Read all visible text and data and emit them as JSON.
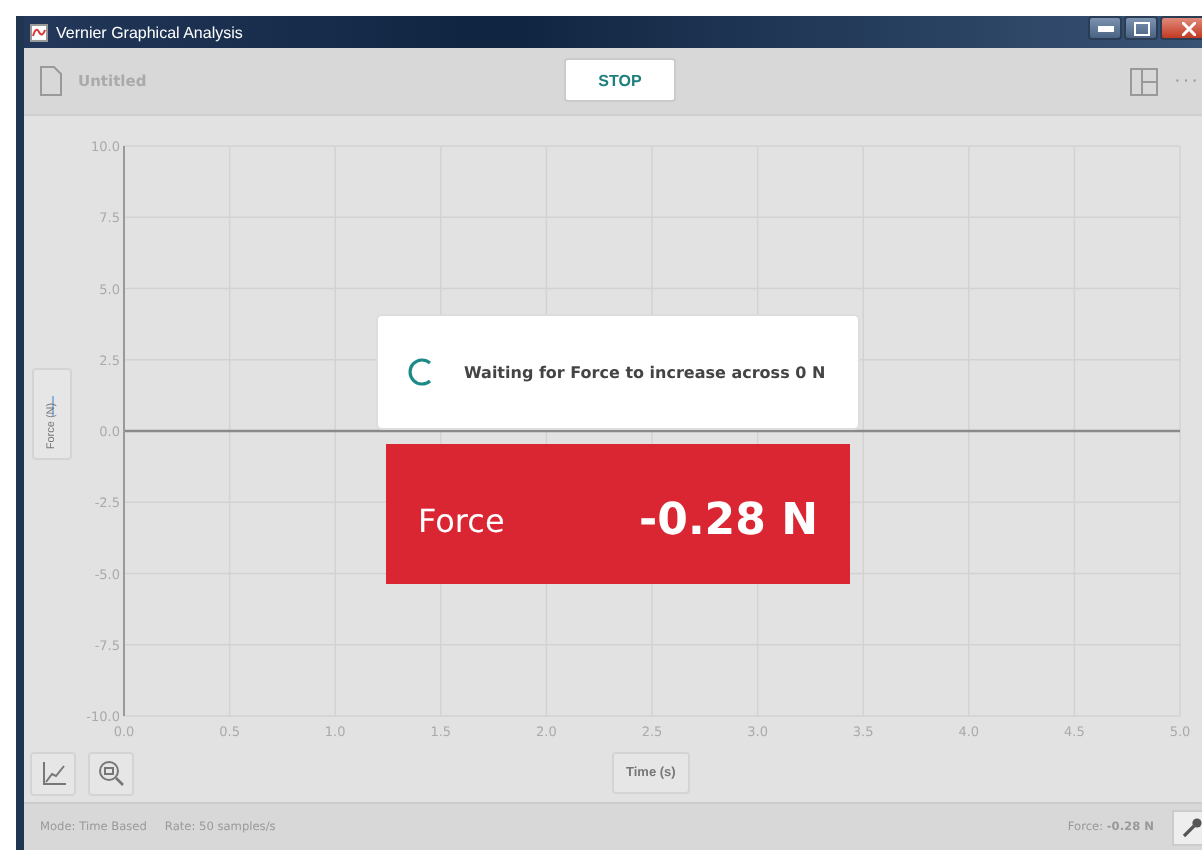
{
  "window": {
    "title": "Vernier Graphical Analysis"
  },
  "toolbar": {
    "file_name": "Untitled",
    "collect_button": "STOP",
    "more_button": "···"
  },
  "graph": {
    "chart_data": {
      "type": "line",
      "grid": true,
      "xlabel": "Time (s)",
      "ylabel": "Force (N)",
      "xlim": [
        0,
        5
      ],
      "ylim": [
        -10,
        10
      ],
      "xticks": [
        {
          "value": 0,
          "label": "0.0"
        },
        {
          "value": 0.5,
          "label": "0.5"
        },
        {
          "value": 1,
          "label": "1.0"
        },
        {
          "value": 1.5,
          "label": "1.5"
        },
        {
          "value": 2,
          "label": "2.0"
        },
        {
          "value": 2.5,
          "label": "2.5"
        },
        {
          "value": 3,
          "label": "3.0"
        },
        {
          "value": 3.5,
          "label": "3.5"
        },
        {
          "value": 4,
          "label": "4.0"
        },
        {
          "value": 4.5,
          "label": "4.5"
        },
        {
          "value": 5,
          "label": "5.0"
        }
      ],
      "yticks": [
        {
          "value": 10,
          "label": "10.0"
        },
        {
          "value": 7.5,
          "label": "7.5"
        },
        {
          "value": 5,
          "label": "5.0"
        },
        {
          "value": 2.5,
          "label": "2.5"
        },
        {
          "value": 0,
          "label": "0.0"
        },
        {
          "value": -2.5,
          "label": "-2.5"
        },
        {
          "value": -5,
          "label": "-5.0"
        },
        {
          "value": -7.5,
          "label": "-7.5"
        },
        {
          "value": -10,
          "label": "-10.0"
        }
      ]
    }
  },
  "trigger_message": "Waiting for Force to increase across 0 N",
  "meter": {
    "name": "Force",
    "reading": "-0.28 N",
    "color": "#d92632"
  },
  "status_bar": {
    "mode": "Mode: Time Based",
    "rate": "Rate: 50 samples/s",
    "reading": "Force: **-0.28 N**"
  }
}
